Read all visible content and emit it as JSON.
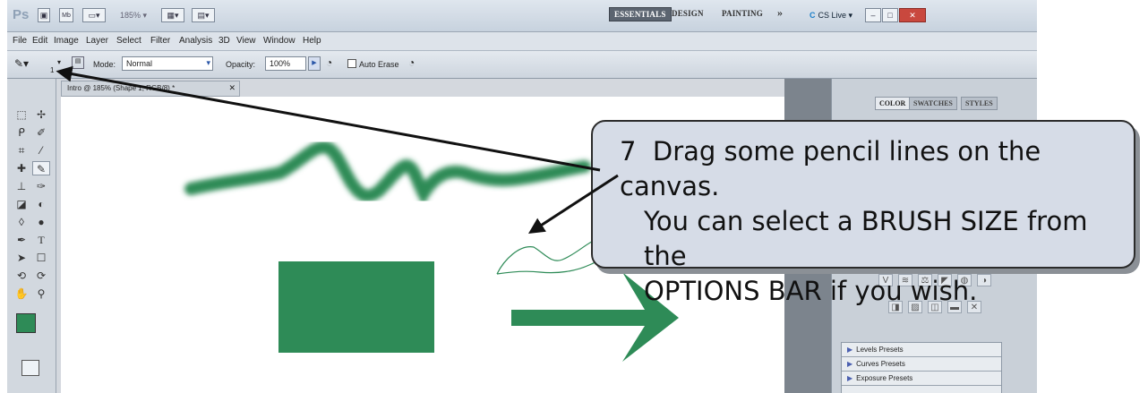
{
  "appbar": {
    "logo": "Ps",
    "zoom": "185%",
    "workspaces": [
      "ESSENTIALS",
      "DESIGN",
      "PAINTING"
    ],
    "more": "»",
    "cslive": "CS Live"
  },
  "menu": [
    "File",
    "Edit",
    "Image",
    "Layer",
    "Select",
    "Filter",
    "Analysis",
    "3D",
    "View",
    "Window",
    "Help"
  ],
  "options": {
    "brush_size": "1",
    "mode_label": "Mode:",
    "mode_value": "Normal",
    "opacity_label": "Opacity:",
    "opacity_value": "100%",
    "auto_erase_label": "Auto Erase"
  },
  "document": {
    "tab_title": "Intro @ 185% (Shape 1, RGB/8) *",
    "accent_color": "#2e8b57"
  },
  "panel": {
    "tabs": [
      "COLOR",
      "SWATCHES",
      "STYLES"
    ],
    "presets": [
      "Levels Presets",
      "Curves Presets",
      "Exposure Presets"
    ]
  },
  "callout": {
    "number": "7",
    "lines": [
      "Drag some pencil lines on the canvas.",
      "You can select a BRUSH SIZE from the",
      "OPTIONS BAR if you wish."
    ]
  }
}
